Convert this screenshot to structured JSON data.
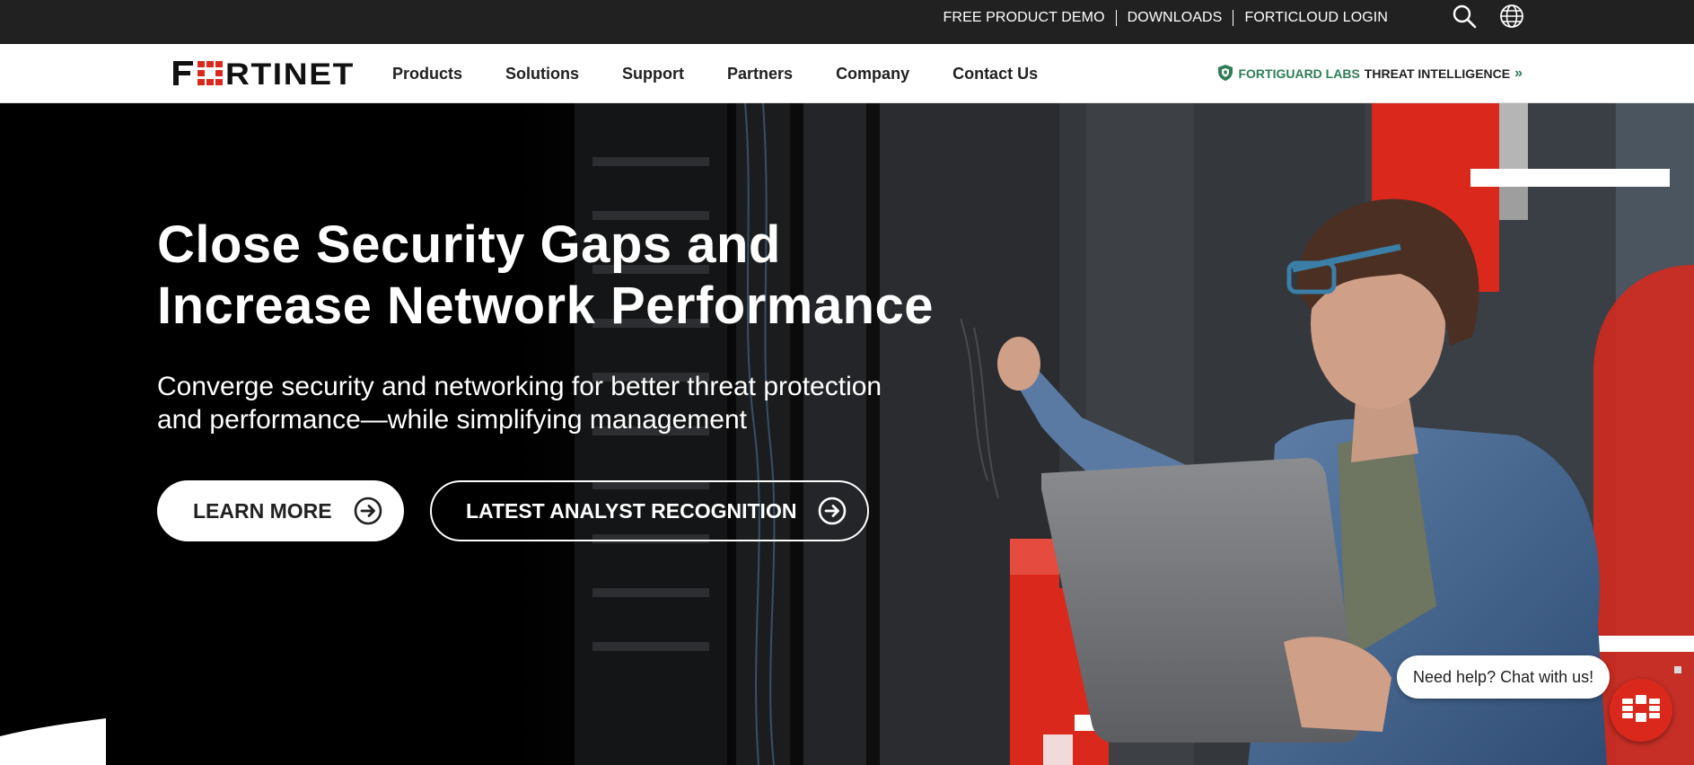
{
  "utility": {
    "links": [
      "FREE PRODUCT DEMO",
      "DOWNLOADS",
      "FORTICLOUD LOGIN"
    ],
    "search_icon": "search-icon",
    "globe_icon": "globe-icon"
  },
  "brand": {
    "logo_text": "FORTINET",
    "red": "#da291c",
    "green": "#2e7d57"
  },
  "nav": {
    "items": [
      "Products",
      "Solutions",
      "Support",
      "Partners",
      "Company",
      "Contact Us"
    ],
    "fortiguard_brand": "FORTIGUARD LABS",
    "fortiguard_rest": "THREAT INTELLIGENCE",
    "fortiguard_chevron": "»"
  },
  "hero": {
    "title_line1": "Close Security Gaps and",
    "title_line2": "Increase Network Performance",
    "subtitle_line1": "Converge security and networking for better threat protection",
    "subtitle_line2": "and performance—while simplifying management",
    "primary_cta": "LEARN MORE",
    "secondary_cta": "LATEST ANALYST RECOGNITION"
  },
  "chat": {
    "prompt": "Need help? Chat with us!"
  }
}
